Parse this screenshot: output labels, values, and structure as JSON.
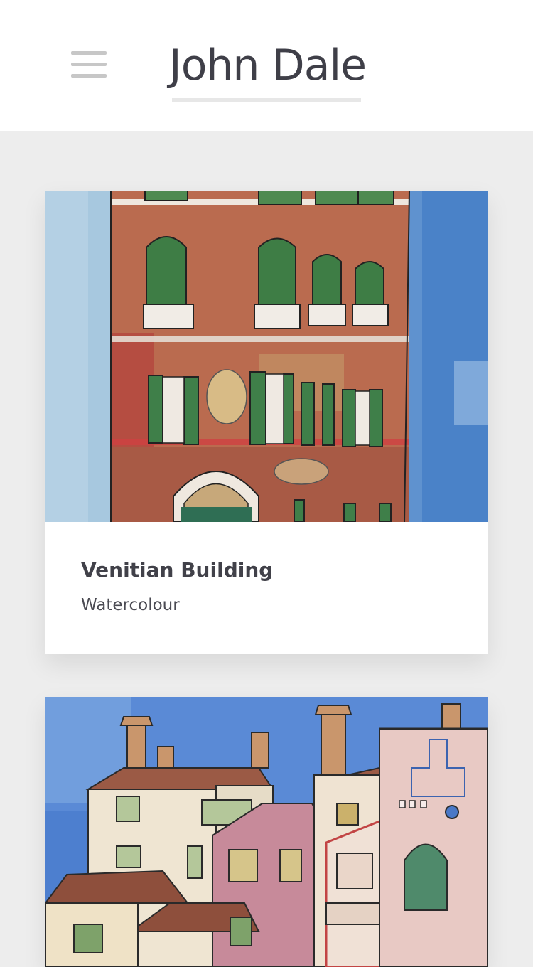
{
  "header": {
    "title": "John Dale",
    "menu_icon": "hamburger-menu-icon"
  },
  "artworks": [
    {
      "title": "Venitian Building",
      "medium": "Watercolour"
    },
    {}
  ],
  "colors": {
    "page_background": "#ededed",
    "header_background": "#ffffff",
    "title_text": "#3f3f48",
    "menu_icon": "#c7c7c7"
  }
}
